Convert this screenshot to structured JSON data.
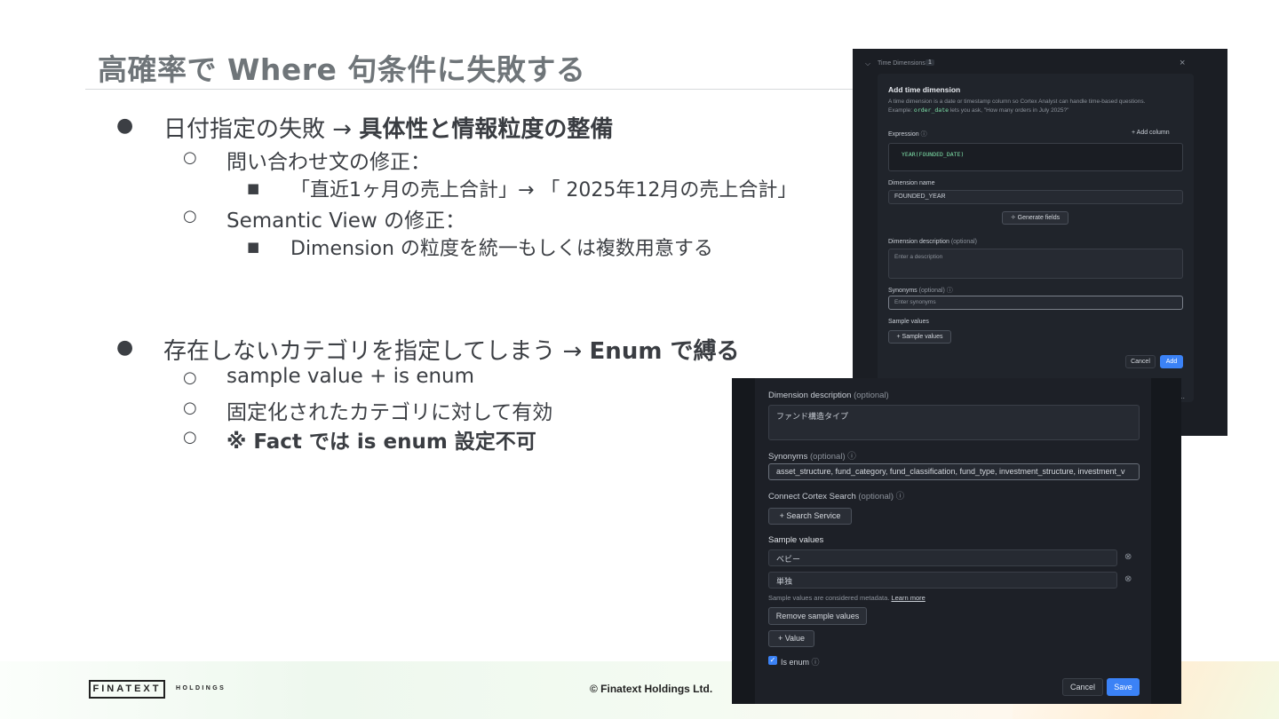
{
  "slide": {
    "title": "高確率で Where 句条件に失敗する",
    "section1": {
      "bullet": "●",
      "text": "日付指定の失敗 → ",
      "strong": "具体性と情報粒度の整備",
      "sub1": {
        "bullet": "○",
        "text": "問い合わせ文の修正："
      },
      "sub1_item": {
        "bullet": "■",
        "text": "「直近1ヶ月の売上合計」→ 「 2025年12月の売上合計」"
      },
      "sub2": {
        "bullet": "○",
        "text": "Semantic View の修正："
      },
      "sub2_item": {
        "bullet": "■",
        "text": "Dimension の粒度を統一もしくは複数用意する"
      }
    },
    "section2": {
      "bullet": "●",
      "text": "存在しないカテゴリを指定してしまう → ",
      "strong": "Enum で縛る",
      "sub1": {
        "bullet": "○",
        "text": "sample value + is enum"
      },
      "sub2": {
        "bullet": "○",
        "text": "固定化されたカテゴリに対して有効"
      },
      "sub3": {
        "bullet": "○",
        "strong": "※ Fact では is enum 設定不可"
      }
    }
  },
  "panel_top": {
    "section_header": "Time Dimensions",
    "count": "1",
    "close": "×",
    "heading": "Add time dimension",
    "desc1": "A time dimension is a date or timestamp column so Cortex Analyst can handle time-based questions.",
    "desc2_pre": "Example: ",
    "desc2_code": "order_date",
    "desc2_post": " lets you ask, \"How many orders in July 2025?\"",
    "expression_label": "Expression",
    "add_column": "+ Add column",
    "expression_value": "YEAR(FOUNDED_DATE)",
    "dim_name_label": "Dimension name",
    "dim_name_value": "FOUNDED_YEAR",
    "generate_fields": "Generate fields",
    "dim_desc_label": "Dimension description",
    "optional": "(optional)",
    "dim_desc_placeholder": "Enter a description",
    "synonyms_label": "Synonyms",
    "synonyms_placeholder": "Enter synonyms",
    "sample_values_label": "Sample values",
    "sample_values_button": "+ Sample values",
    "cancel": "Cancel",
    "add": "Add",
    "ellipsis": ".."
  },
  "panel_bottom": {
    "dim_desc_label": "Dimension description",
    "optional": "(optional)",
    "dim_desc_value": "ファンド構造タイプ",
    "synonyms_label": "Synonyms",
    "synonyms_value": "asset_structure, fund_category, fund_classification, fund_type, investment_structure, investment_v",
    "connect_label": "Connect Cortex Search",
    "search_service": "+ Search Service",
    "sample_values_label": "Sample values",
    "sample_values": [
      "ベビー",
      "単独"
    ],
    "metadata_note": "Sample values are considered metadata.",
    "learn_more": "Learn more",
    "remove_sample": "Remove sample values",
    "add_value": "+ Value",
    "is_enum": "Is enum",
    "cancel": "Cancel",
    "save": "Save"
  },
  "footer": {
    "logo": "FINATEXT",
    "holdings": "HOLDINGS",
    "copyright": "© Finatext Holdings Ltd."
  },
  "colors": {
    "accent": "#3b82f6",
    "title": "#6f7579",
    "text": "#3c3f44",
    "panel_bg": "#1b1e24"
  }
}
